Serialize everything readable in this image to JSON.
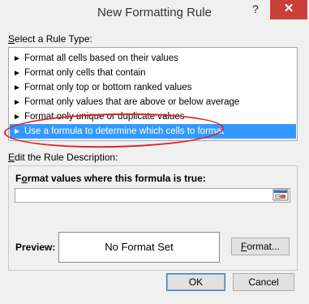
{
  "window": {
    "title": "New Formatting Rule",
    "help_label": "?",
    "close_label": "✕"
  },
  "rule_type": {
    "label_prefix": "",
    "label_underlined": "S",
    "label_rest": "elect a Rule Type:",
    "items": [
      {
        "label": "Format all cells based on their values"
      },
      {
        "label": "Format only cells that contain"
      },
      {
        "label": "Format only top or bottom ranked values"
      },
      {
        "label": "Format only values that are above or below average"
      },
      {
        "label": "Format only unique or duplicate values"
      },
      {
        "label": "Use a formula to determine which cells to format"
      }
    ],
    "selected_index": 5,
    "bullet": "►"
  },
  "description": {
    "label_underlined": "E",
    "label_rest": "dit the Rule Description:",
    "formula_label_underlined": "o",
    "formula_label_before": "F",
    "formula_label_after": "rmat values where this formula is true:",
    "formula_value": ""
  },
  "preview": {
    "label": "Preview:",
    "text": "No Format Set"
  },
  "buttons": {
    "format_underlined": "F",
    "format_rest": "ormat...",
    "ok": "OK",
    "cancel": "Cancel"
  },
  "colors": {
    "selection": "#3399ff",
    "annotation": "#e02020",
    "close_button": "#c9403a"
  }
}
